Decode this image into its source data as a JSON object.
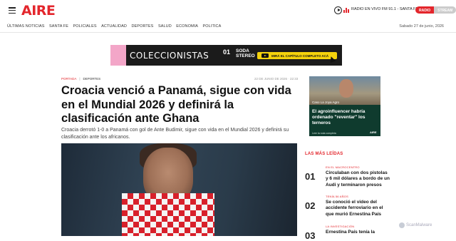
{
  "header": {
    "logo": "AIRE",
    "radio_text": "RADIO EN VIVO FM 91.1 - SANTA FE",
    "radio_btn": "RADIO",
    "stream_btn": "STREAM"
  },
  "nav": {
    "items": [
      "ÚLTIMAS NOTICIAS",
      "SANTA FE",
      "POLICIALES",
      "ACTUALIDAD",
      "DEPORTES",
      "SALUD",
      "ECONOMIA",
      "POLITICA"
    ],
    "date": "Sabado 27 de junio, 2026"
  },
  "banner": {
    "title": "COLECCIONISTAS",
    "number": "01",
    "soda": "SODA\nSTEREO",
    "cta": "MIRÁ EL CAPÍTULO COMPLETO ACÁ"
  },
  "article": {
    "crumb_home": "PORTADA",
    "crumb_section": "DEPORTES",
    "date": "22 DE JUNIO DE 2026 · 22:33",
    "headline": "Croacia venció a Panamá, sigue con vida en el Mundial 2026 y definirá la clasificación ante Ghana",
    "lead": "Croacia derrotó 1-0 a Panamá con gol de Ante Budimir, sigue con vida en el Mundial 2026 y definirá su clasificación ante los africanos."
  },
  "side_ad": {
    "tag": "Caso La Joya Agro",
    "headline": "El agroinfluencer habría ordenado \"reventar\" los terneros",
    "more": "Leer la nota completa",
    "logo": "AIRE"
  },
  "most_read": {
    "title": "LAS MÁS LEÍDAS",
    "items": [
      {
        "num": "01",
        "cat": "EN EL MACROCENTRO",
        "title": "Circulaban con dos pistolas y 6 mil dólares a bordo de un Audi y terminaron presos"
      },
      {
        "num": "02",
        "cat": "TENÍA 56 AÑOS",
        "title": "Se conoció el video del accidente ferroviario en el que murió Ernestina País"
      },
      {
        "num": "03",
        "cat": "LA INVESTIGACIÓN",
        "title": "Ernestina País tenía la"
      }
    ]
  },
  "watermark": "ScanMalware"
}
